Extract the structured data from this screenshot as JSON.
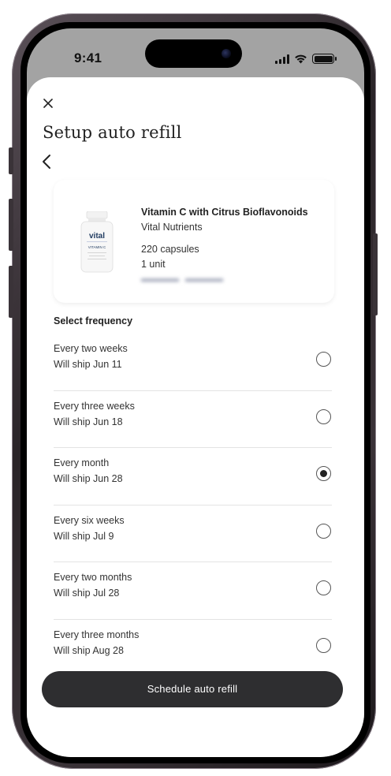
{
  "status_bar": {
    "time": "9:41"
  },
  "sheet": {
    "close_icon": "close-icon",
    "title": "Setup auto refill",
    "back_icon": "chevron-left-icon"
  },
  "product": {
    "name": "Vitamin C with Citrus Bioflavonoids",
    "brand": "Vital Nutrients",
    "quantity": "220 capsules",
    "units": "1 unit",
    "bottle_brand": "vital",
    "bottle_label": "VITAMIN C"
  },
  "frequency": {
    "heading": "Select frequency",
    "options": [
      {
        "label": "Every two weeks",
        "ship": "Will ship Jun 11",
        "selected": false
      },
      {
        "label": "Every three weeks",
        "ship": "Will ship Jun 18",
        "selected": false
      },
      {
        "label": "Every month",
        "ship": "Will ship Jun 28",
        "selected": true
      },
      {
        "label": "Every six weeks",
        "ship": "Will ship Jul 9",
        "selected": false
      },
      {
        "label": "Every two months",
        "ship": "Will ship Jul 28",
        "selected": false
      },
      {
        "label": "Every three months",
        "ship": "Will ship Aug 28",
        "selected": false
      }
    ]
  },
  "cta": {
    "label": "Schedule auto refill"
  },
  "colors": {
    "cta_bg": "#2e2e30",
    "radio_fill": "#222222",
    "price_blur": "#9aa0b4"
  }
}
